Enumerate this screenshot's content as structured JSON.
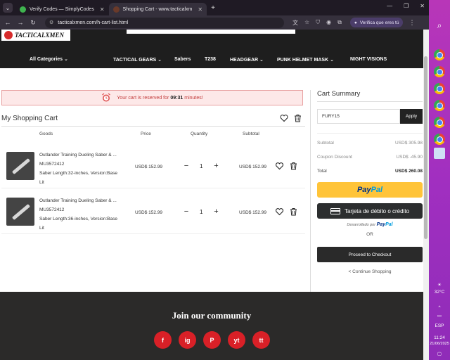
{
  "browser": {
    "tabs": [
      {
        "title": "Verify Codes — SimplyCodes",
        "color": "#3fb34f"
      },
      {
        "title": "Shopping Cart - www.tacticalxm",
        "color": "#6a3a2a"
      }
    ],
    "url": "tacticalxmen.com/h-cart-list.html",
    "verify_label": "Verifica que eres tú"
  },
  "site": {
    "logo_text": "TACTICALXMEN",
    "nav": {
      "all_categories": "All Categories",
      "items": [
        "TACTICAL GEARS",
        "Sabers",
        "T238",
        "HEADGEAR",
        "PUNK HELMET MASK",
        "NIGHT VISIONS"
      ]
    }
  },
  "cart": {
    "reserve_prefix": "Your cart is reserved for",
    "reserve_time": "09:31",
    "reserve_suffix": "minutes!",
    "title": "My Shopping Cart",
    "columns": {
      "goods": "Goods",
      "price": "Price",
      "quantity": "Quantity",
      "subtotal": "Subtotal"
    },
    "items": [
      {
        "name": "Outlander Training Dueling Saber & ...",
        "sku": "MU3572412",
        "option1": "Saber Length:32-inches, Version:Base",
        "option2": "Lit",
        "price": "USD$ 152.99",
        "qty": "1",
        "subtotal": "USD$ 152.99"
      },
      {
        "name": "Outlander Training Dueling Saber & ...",
        "sku": "MU3572412",
        "option1": "Saber Length:36-inches, Version:Base",
        "option2": "Lit",
        "price": "USD$ 152.99",
        "qty": "1",
        "subtotal": "USD$ 152.99"
      }
    ]
  },
  "summary": {
    "title": "Cart Summary",
    "coupon_value": "FURY15",
    "apply_label": "Apply",
    "subtotal_label": "Subtotal",
    "subtotal_value": "USD$ 305.98",
    "discount_label": "Coupon Discount",
    "discount_value": "USD$ -45.90",
    "total_label": "Total",
    "total_value": "USD$ 260.08",
    "paypal_a": "Pay",
    "paypal_b": "Pal",
    "debit_label": "Tarjeta de débito o crédito",
    "powered_prefix": "Desarrollado por",
    "or_label": "OR",
    "checkout_label": "Proceed to Checkout",
    "continue_label": "< Continue Shopping"
  },
  "footer": {
    "join_title": "Join our community",
    "socials": [
      "f",
      "ig",
      "P",
      "yt",
      "tt"
    ]
  },
  "taskbar": {
    "temp": "32°C",
    "lang": "ESP",
    "time": "11:24",
    "date": "21/06/2025"
  }
}
